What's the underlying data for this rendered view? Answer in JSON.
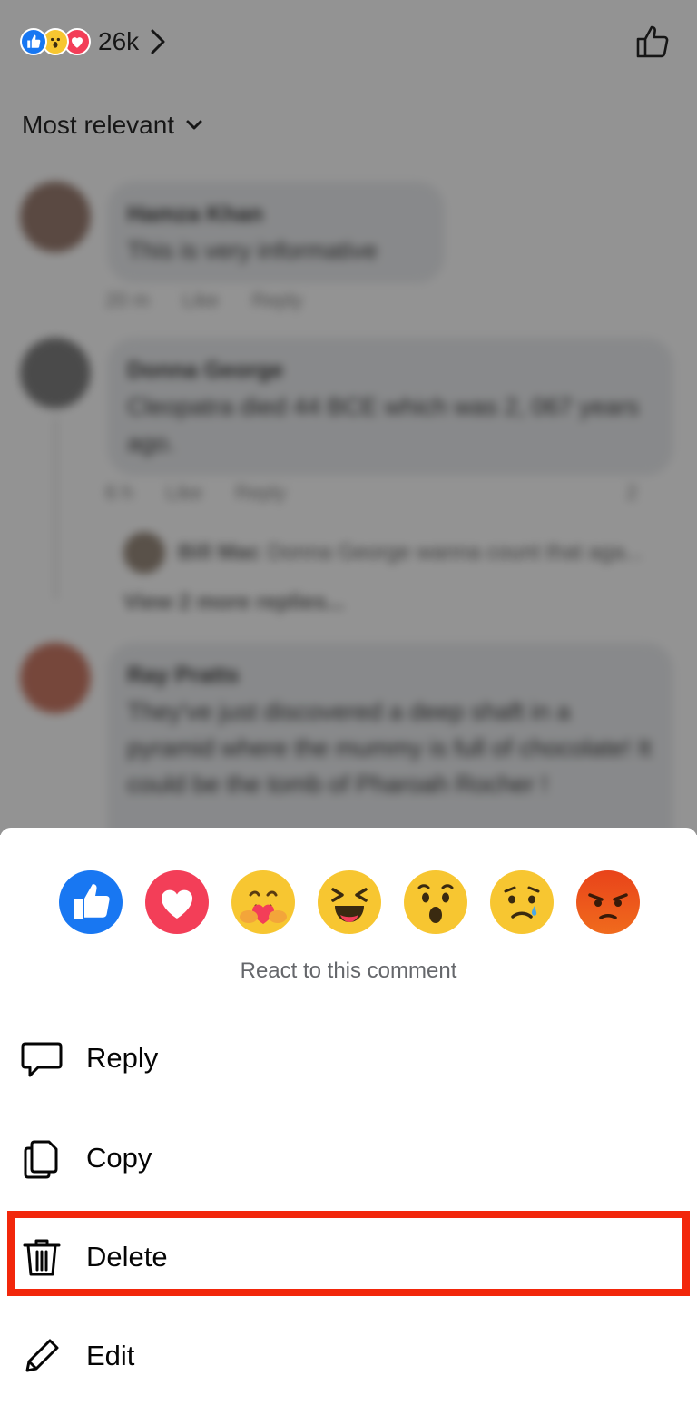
{
  "header": {
    "reaction_count": "26k",
    "reaction_icons": [
      "like-icon",
      "wow-icon",
      "love-icon"
    ]
  },
  "sort": {
    "label": "Most relevant"
  },
  "comments": [
    {
      "author": "Hamza Khan",
      "text": "This is very informative",
      "meta": [
        "20 m",
        "Like",
        "Reply"
      ]
    },
    {
      "author": "Donna George",
      "text": "Cleopatra died 44 BCE which was 2, 067 years ago.",
      "meta": [
        "6 h",
        "Like",
        "Reply"
      ],
      "reaction_count": "2"
    },
    {
      "author": "Ray Pratts",
      "text": "They've just discovered a deep shaft in a pyramid where the mummy is full of chocolate! It could be the tomb of Pharoah Rocher !"
    }
  ],
  "reply_preview": {
    "author": "Bill Mac",
    "text": "Donna George wanna count that aga...",
    "more": "View 2 more replies..."
  },
  "reactions": {
    "items": [
      "like",
      "love",
      "care",
      "haha",
      "wow",
      "sad",
      "angry"
    ],
    "hint": "React to this comment"
  },
  "menu": {
    "reply": "Reply",
    "copy": "Copy",
    "delete": "Delete",
    "edit": "Edit"
  },
  "colors": {
    "highlight": "#f2270b",
    "like_blue": "#1877f2",
    "love_red": "#f33e58",
    "emoji_yellow": "#f7c631"
  }
}
